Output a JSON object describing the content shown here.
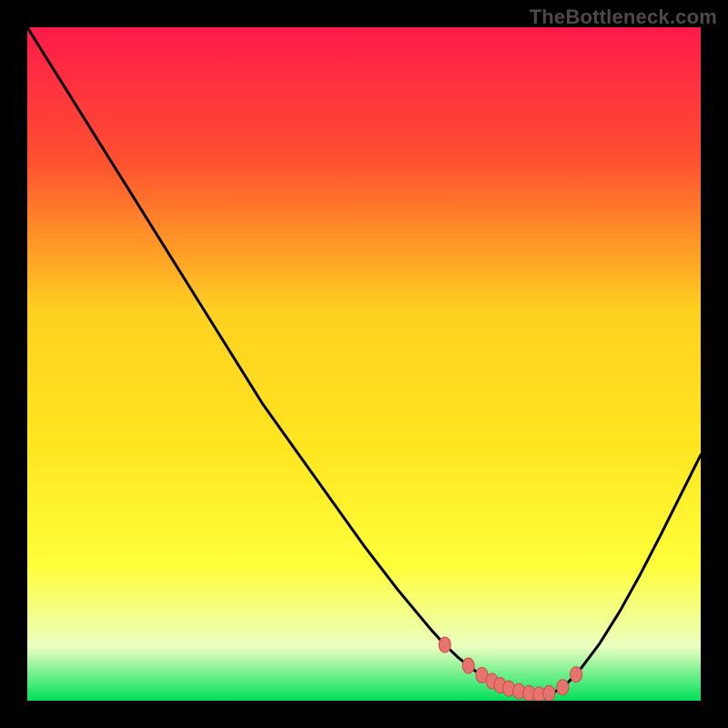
{
  "watermark": "TheBottleneck.com",
  "colors": {
    "background": "#000000",
    "gradient_top": "#ff1a4b",
    "gradient_mid_upper": "#ff6a2a",
    "gradient_mid": "#ffd020",
    "gradient_mid_lower": "#ffff3a",
    "gradient_low": "#f4ffb8",
    "gradient_bottom": "#00e05a",
    "curve": "#000000",
    "dot_fill": "#e6736e",
    "dot_stroke": "#c94f49"
  },
  "chart_data": {
    "type": "line",
    "title": "",
    "xlabel": "",
    "ylabel": "",
    "xlim": [
      0,
      100
    ],
    "ylim": [
      0,
      100
    ],
    "x": [
      0,
      5,
      10,
      15,
      20,
      25,
      30,
      35,
      40,
      45,
      50,
      55,
      60,
      62,
      64,
      66,
      68,
      70,
      72,
      74,
      76,
      78,
      80,
      82,
      85,
      88,
      91,
      94,
      97,
      100
    ],
    "values": [
      100,
      92,
      84,
      76,
      68,
      60,
      52,
      44,
      37,
      30,
      23,
      16.5,
      10.5,
      8.3,
      6.4,
      4.8,
      3.4,
      2.4,
      1.6,
      1.1,
      0.9,
      1.1,
      2.4,
      4.5,
      8.5,
      13.3,
      18.7,
      24.5,
      30.5,
      36.5
    ],
    "markers_x": [
      62,
      65.5,
      67.5,
      69,
      70.2,
      71.5,
      73,
      74.5,
      76,
      77.5,
      79.5,
      81.5
    ],
    "markers_y": [
      8.3,
      5.2,
      3.8,
      2.9,
      2.3,
      1.8,
      1.4,
      1.1,
      0.9,
      1.1,
      2.0,
      3.9
    ]
  }
}
